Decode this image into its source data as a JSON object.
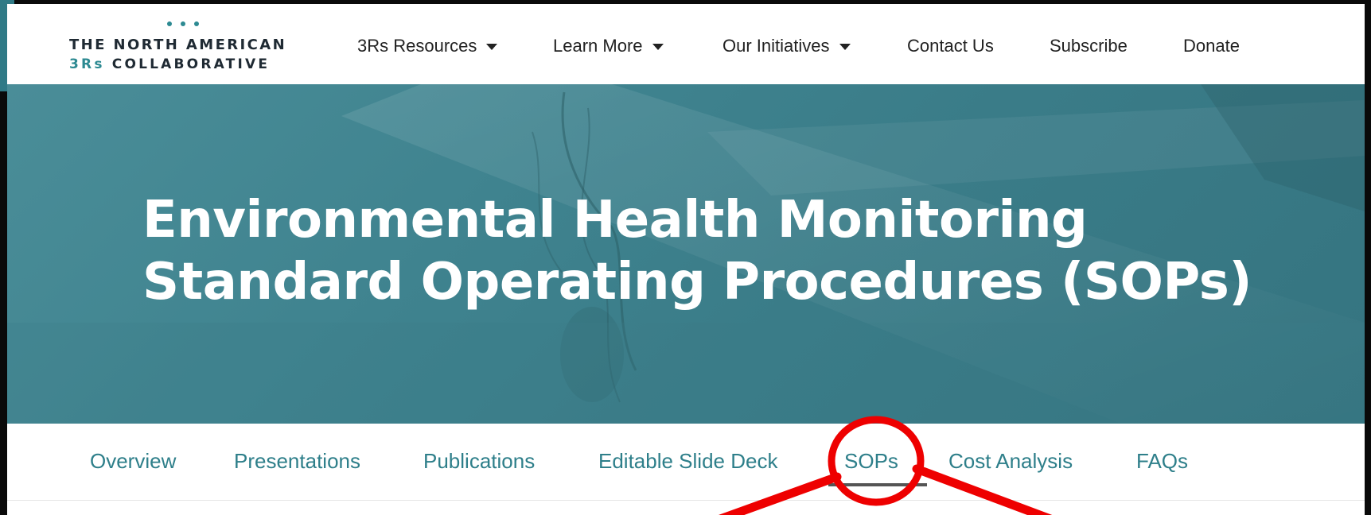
{
  "logo": {
    "line1": "THE NORTH AMERICAN",
    "line2_accent": "3Rs",
    "line2_rest": "COLLABORATIVE"
  },
  "nav": {
    "items": [
      {
        "label": "3Rs Resources",
        "has_dropdown": true
      },
      {
        "label": "Learn More",
        "has_dropdown": true
      },
      {
        "label": "Our Initiatives",
        "has_dropdown": true
      },
      {
        "label": "Contact Us",
        "has_dropdown": false
      },
      {
        "label": "Subscribe",
        "has_dropdown": false
      },
      {
        "label": "Donate",
        "has_dropdown": false
      }
    ]
  },
  "hero": {
    "title_line1": "Environmental Health Monitoring",
    "title_line2": "Standard Operating Procedures (SOPs)"
  },
  "sub_nav": {
    "active": "SOPs",
    "items": [
      {
        "label": "Overview"
      },
      {
        "label": "Presentations"
      },
      {
        "label": "Publications"
      },
      {
        "label": "Editable Slide Deck"
      },
      {
        "label": "SOPs"
      },
      {
        "label": "Cost Analysis"
      },
      {
        "label": "FAQs"
      }
    ]
  },
  "colors": {
    "brand_teal": "#2d8a92",
    "hero_bg": "#428792",
    "sub_nav_text": "#2e7f8a",
    "annotation_red": "#ee0000",
    "active_underline": "#555555"
  }
}
